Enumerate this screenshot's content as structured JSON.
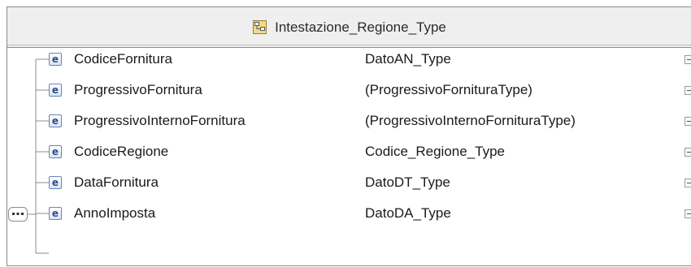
{
  "header": {
    "title": "Intestazione_Regione_Type",
    "icon": "complex-type-icon"
  },
  "compositor": {
    "icon": "sequence-icon"
  },
  "elements": [
    {
      "badge": "e",
      "name": "CodiceFornitura",
      "type": "DatoAN_Type"
    },
    {
      "badge": "e",
      "name": "ProgressivoFornitura",
      "type": "(ProgressivoFornituraType)"
    },
    {
      "badge": "e",
      "name": "ProgressivoInternoFornitura",
      "type": "(ProgressivoInternoFornituraType)"
    },
    {
      "badge": "e",
      "name": "CodiceRegione",
      "type": "Codice_Regione_Type"
    },
    {
      "badge": "e",
      "name": "DataFornitura",
      "type": "DatoDT_Type"
    },
    {
      "badge": "e",
      "name": "AnnoImposta",
      "type": "DatoDA_Type"
    }
  ],
  "colors": {
    "header_bg": "#efefef",
    "border": "#8a8a8a",
    "badge_text": "#2b4e8c"
  }
}
